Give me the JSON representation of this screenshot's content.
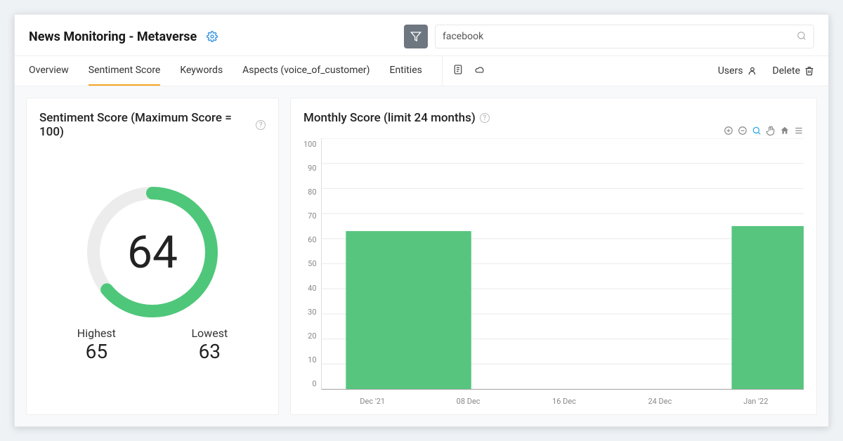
{
  "header": {
    "title": "News Monitoring - Metaverse",
    "search_value": "facebook"
  },
  "tabs": [
    "Overview",
    "Sentiment Score",
    "Keywords",
    "Aspects (voice_of_customer)",
    "Entities"
  ],
  "active_tab": 1,
  "actions": {
    "users": "Users",
    "delete": "Delete"
  },
  "sentiment_card": {
    "title": "Sentiment Score (Maximum Score = 100)",
    "score": 64,
    "highest_label": "Highest",
    "highest": 65,
    "lowest_label": "Lowest",
    "lowest": 63
  },
  "monthly_card": {
    "title": "Monthly Score (limit 24 months)"
  },
  "chart_data": {
    "type": "bar",
    "title": "Monthly Score (limit 24 months)",
    "xlabel": "",
    "ylabel": "",
    "ylim": [
      0,
      100
    ],
    "yticks": [
      0,
      10,
      20,
      30,
      40,
      50,
      60,
      70,
      80,
      90,
      100
    ],
    "xticks": [
      "Dec '21",
      "08 Dec",
      "16 Dec",
      "24 Dec",
      "Jan '22"
    ],
    "series": [
      {
        "name": "Score",
        "points": [
          {
            "x_label": "Dec '21",
            "value": 63
          },
          {
            "x_label": "Jan '22",
            "value": 65
          }
        ]
      }
    ]
  }
}
